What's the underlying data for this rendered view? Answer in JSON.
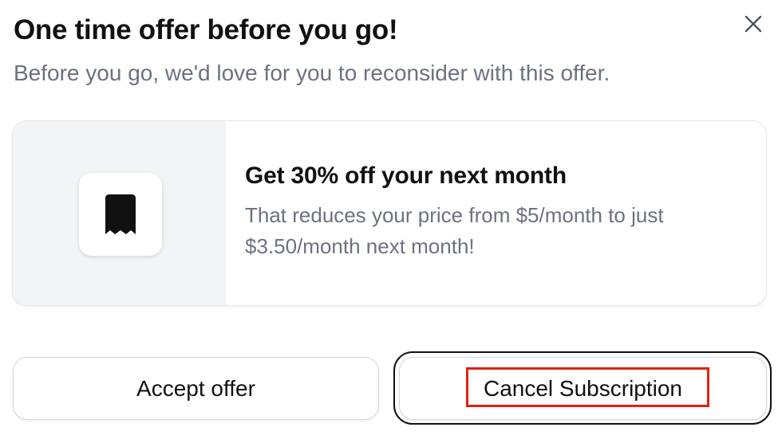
{
  "dialog": {
    "title": "One time offer before you go!",
    "subtitle": "Before you go, we'd love for you to reconsider with this offer.",
    "close_icon": "close-icon"
  },
  "offer": {
    "icon": "receipt-icon",
    "heading": "Get 30% off your next month",
    "description": "That reduces your price from $5/month to just $3.50/month next month!"
  },
  "actions": {
    "accept_label": "Accept offer",
    "cancel_label": "Cancel Subscription"
  },
  "colors": {
    "highlight": "#e3200f",
    "muted_text": "#6b7280",
    "panel_bg": "#f3f4f6"
  }
}
